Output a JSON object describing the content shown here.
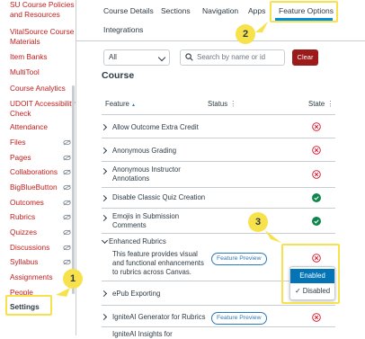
{
  "sidebar": {
    "items": [
      {
        "label": "SU Course Policies and Resources",
        "lines": [
          "SU Course Policies",
          "and Resources"
        ]
      },
      {
        "label": "VitalSource Course Materials",
        "lines": [
          "VitalSource Course",
          "Materials"
        ]
      },
      {
        "label": "Item Banks",
        "lines": [
          "Item Banks"
        ]
      },
      {
        "label": "MultiTool",
        "lines": [
          "MultiTool"
        ]
      },
      {
        "label": "Course Analytics",
        "lines": [
          "Course Analytics"
        ]
      },
      {
        "label": "UDOIT Accessibility Check",
        "lines": [
          "UDOIT Accessibility",
          "Check"
        ]
      },
      {
        "label": "Attendance",
        "lines": [
          "Attendance"
        ]
      },
      {
        "label": "Files",
        "lines": [
          "Files"
        ]
      },
      {
        "label": "Pages",
        "lines": [
          "Pages"
        ]
      },
      {
        "label": "Collaborations",
        "lines": [
          "Collaborations"
        ]
      },
      {
        "label": "BigBlueButton",
        "lines": [
          "BigBlueButton"
        ]
      },
      {
        "label": "Outcomes",
        "lines": [
          "Outcomes"
        ]
      },
      {
        "label": "Rubrics",
        "lines": [
          "Rubrics"
        ]
      },
      {
        "label": "Quizzes",
        "lines": [
          "Quizzes"
        ]
      },
      {
        "label": "Discussions",
        "lines": [
          "Discussions"
        ]
      },
      {
        "label": "Syllabus",
        "lines": [
          "Syllabus"
        ]
      },
      {
        "label": "Assignments",
        "lines": [
          "Assignments"
        ]
      },
      {
        "label": "People",
        "lines": [
          "People"
        ]
      },
      {
        "label": "Settings",
        "lines": [
          "Settings"
        ]
      }
    ]
  },
  "tabs": {
    "course_details": "Course Details",
    "sections": "Sections",
    "navigation": "Navigation",
    "apps": "Apps",
    "feature_options": "Feature Options",
    "integrations": "Integrations"
  },
  "filter": {
    "selected": "All",
    "search_placeholder": "Search by name or id",
    "clear_label": "Clear"
  },
  "section_title": "Course",
  "table": {
    "col_feature": "Feature",
    "col_feature_sort": "▲",
    "col_status": "Status",
    "col_state": "State",
    "rows": [
      {
        "name": [
          "Allow Outcome Extra Credit"
        ],
        "state": "disabled"
      },
      {
        "name": [
          "Anonymous Grading"
        ],
        "state": "disabled"
      },
      {
        "name": [
          "Anonymous Instructor",
          "Annotations"
        ],
        "state": "disabled"
      },
      {
        "name": [
          "Disable Classic Quiz Creation"
        ],
        "state": "enabled"
      },
      {
        "name": [
          "Emojis in Submission",
          "Comments"
        ],
        "state": "enabled"
      },
      {
        "name": [
          "Enhanced Rubrics"
        ],
        "state": "disabled",
        "expanded": true,
        "description": [
          "This feature provides visual",
          "and functional enhancements",
          "to rubrics across Canvas."
        ],
        "status": "Feature Preview"
      },
      {
        "name": [
          "ePub Exporting"
        ],
        "state": "disabled"
      },
      {
        "name": [
          "IgniteAI Generator for Rubrics"
        ],
        "status": "Feature Preview",
        "state": "disabled"
      },
      {
        "name": [
          "IgniteAI Insights for"
        ]
      }
    ]
  },
  "state_menu": {
    "enabled": "Enabled",
    "disabled": "Disabled",
    "checkmark": "✓"
  },
  "callouts": {
    "one": "1",
    "two": "2",
    "three": "3"
  },
  "colors": {
    "link": "#c21c1c",
    "accent": "#008ee2",
    "highlight": "#f7e24b",
    "enabled_green": "#0b874b",
    "disabled_red": "#e0061f"
  }
}
